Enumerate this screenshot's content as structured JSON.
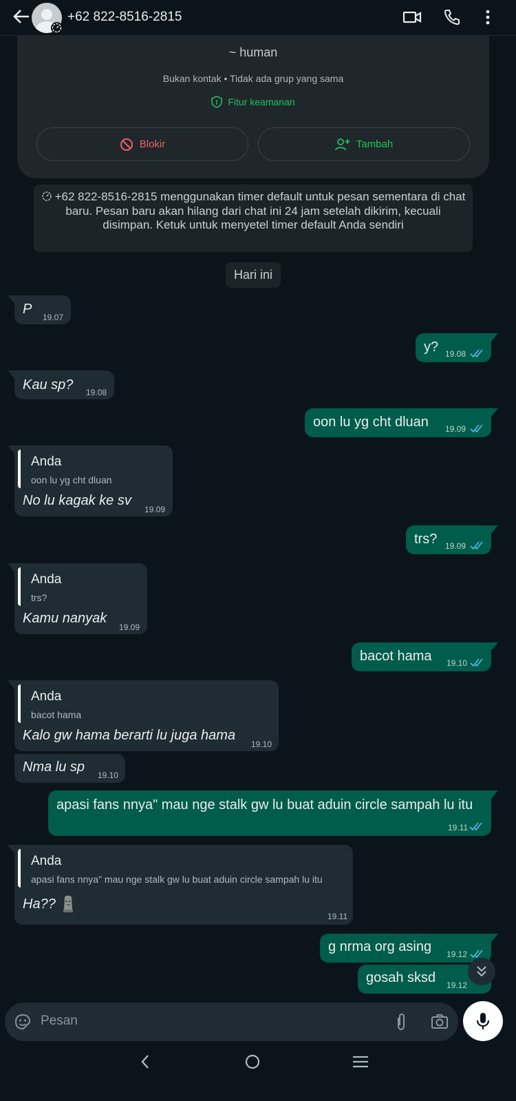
{
  "header": {
    "title": "+62 822-8516-2815"
  },
  "profile": {
    "nickname": "~ human",
    "info": "Bukan kontak • Tidak ada grup yang sama",
    "security_label": "Fitur keamanan",
    "block_label": "Blokir",
    "add_label": "Tambah"
  },
  "notice": {
    "text": "+62 822-8516-2815 menggunakan timer default untuk pesan sementara di chat baru. Pesan baru akan hilang dari chat ini 24 jam setelah dikirim, kecuali disimpan. Ketuk untuk menyetel timer default Anda sendiri"
  },
  "date_chip": "Hari ini",
  "messages": [
    {
      "dir": "in",
      "text": "P",
      "time": "19.07"
    },
    {
      "dir": "out",
      "text": "y?",
      "time": "19.08"
    },
    {
      "dir": "in",
      "text": "Kau sp?",
      "time": "19.08"
    },
    {
      "dir": "out",
      "text": "oon lu yg cht dluan",
      "time": "19.09"
    },
    {
      "dir": "in",
      "quote_name": "Anda",
      "quote_text": "oon lu yg cht dluan",
      "text": "No lu kagak ke sv",
      "time": "19.09"
    },
    {
      "dir": "out",
      "text": "trs?",
      "time": "19.09"
    },
    {
      "dir": "in",
      "quote_name": "Anda",
      "quote_text": "trs?",
      "text": "Kamu nanyak",
      "time": "19.09"
    },
    {
      "dir": "out",
      "text": "bacot hama",
      "time": "19.10"
    },
    {
      "dir": "in",
      "quote_name": "Anda",
      "quote_text": "bacot hama",
      "text": "Kalo gw hama berarti lu juga hama",
      "time": "19.10"
    },
    {
      "dir": "in",
      "text": "Nma lu sp",
      "time": "19.10"
    },
    {
      "dir": "out",
      "text": "apasi fans nnya\" mau nge stalk gw lu buat aduin circle sampah lu itu",
      "time": "19.11"
    },
    {
      "dir": "in",
      "quote_name": "Anda",
      "quote_text": "apasi fans nnya\" mau nge stalk gw lu buat aduin circle sampah lu itu",
      "text": "Ha??",
      "time": "19.11"
    },
    {
      "dir": "out",
      "text": "g nrma org asing",
      "time": "19.12"
    },
    {
      "dir": "out",
      "text": "gosah sksd",
      "time": "19.12"
    }
  ],
  "composer": {
    "placeholder": "Pesan"
  },
  "colors": {
    "background": "#0b141a",
    "incoming_bubble": "#1f2c33",
    "outgoing_bubble": "#005c4b",
    "accent_green": "#21c063",
    "block_red": "#f15c6d",
    "read_ticks": "#53bdeb"
  }
}
